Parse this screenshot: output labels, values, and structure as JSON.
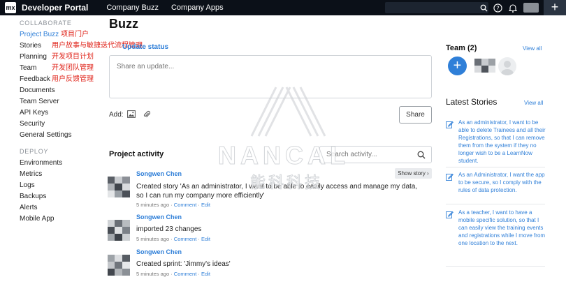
{
  "topbar": {
    "logo_text": "mx",
    "brand": "Developer Portal",
    "nav": [
      "Company Buzz",
      "Company Apps"
    ],
    "plus_label": "+"
  },
  "sidebar": {
    "collaborate_title": "COLLABORATE",
    "collaborate_items": [
      {
        "label": "Project Buzz",
        "note": "项目门户"
      },
      {
        "label": "Stories",
        "note": "用户故事与敏捷迭代流程管理"
      },
      {
        "label": "Planning",
        "note": "开发项目计划"
      },
      {
        "label": "Team",
        "note": "开发团队管理"
      },
      {
        "label": "Feedback",
        "note": "用户反馈管理"
      },
      {
        "label": "Documents",
        "note": ""
      },
      {
        "label": "Team Server",
        "note": ""
      },
      {
        "label": "API Keys",
        "note": ""
      },
      {
        "label": "Security",
        "note": ""
      },
      {
        "label": "General Settings",
        "note": ""
      }
    ],
    "deploy_title": "DEPLOY",
    "deploy_items": [
      "Environments",
      "Metrics",
      "Logs",
      "Backups",
      "Alerts",
      "Mobile App"
    ]
  },
  "main": {
    "title": "Buzz",
    "update_status_label": "Update status",
    "update_placeholder": "Share an update...",
    "add_label": "Add:",
    "share_button": "Share",
    "activity_title": "Project activity",
    "activity_search_placeholder": "Search activity...",
    "show_story": "Show story ›",
    "activities": [
      {
        "name": "Songwen Chen",
        "text": "Created story 'As an administrator, I want to be able to easily access and manage my data, so I can run my company more efficiently'",
        "time": "5 minutes ago",
        "comment": "Comment",
        "edit": "Edit"
      },
      {
        "name": "Songwen Chen",
        "text": "imported 23 changes",
        "time": "5 minutes ago",
        "comment": "Comment",
        "edit": "Edit"
      },
      {
        "name": "Songwen Chen",
        "text": "Created sprint: 'Jimmy's ideas'",
        "time": "5 minutes ago",
        "comment": "Comment",
        "edit": "Edit"
      }
    ]
  },
  "right": {
    "team_title": "Team (2)",
    "team_view_all": "View all",
    "stories_title": "Latest Stories",
    "stories_view_all": "View all",
    "stories": [
      "As an administrator, I want to be able to delete Trainees and all their Registrations, so that I can remove them from the system if they no longer wish to be a LearnNow student.",
      "As an Administrator, I want the app to be secure, so I comply with the rules of data protection.",
      "As a teacher, I want to have a mobile specific solution, so that I can easily view the training events and registrations while I move from one location to the next."
    ]
  },
  "watermark": {
    "text": "NANCAL",
    "sub": "能科科技"
  },
  "colors": {
    "topbar_bg": "#0b1018",
    "accent": "#2f7fd8",
    "annotation_red": "#e0261c"
  }
}
